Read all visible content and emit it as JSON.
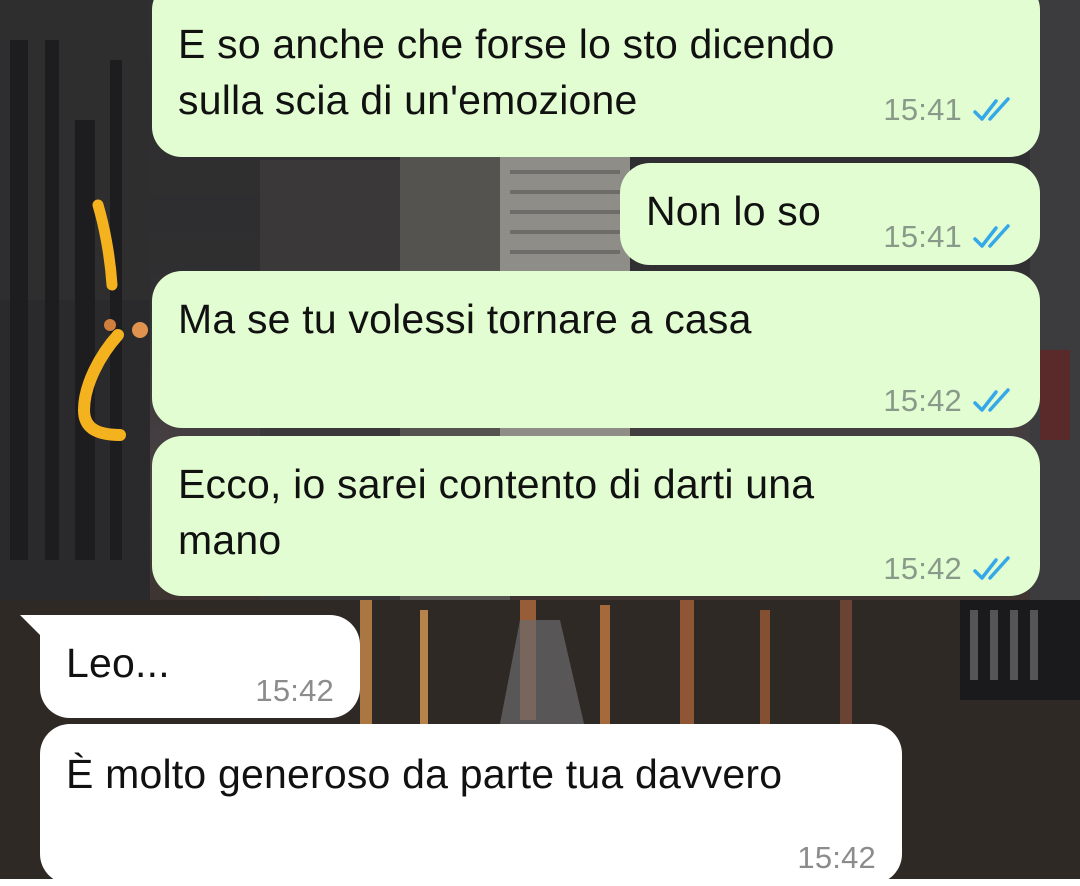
{
  "chat": {
    "messages": [
      {
        "direction": "outgoing",
        "lines": [
          "E so anche che forse lo sto dicendo",
          "sulla scia di un'emozione"
        ],
        "time": "15:41",
        "read_icon": "double-check-icon"
      },
      {
        "direction": "outgoing",
        "lines": [
          "Non lo so"
        ],
        "time": "15:41",
        "read_icon": "double-check-icon"
      },
      {
        "direction": "outgoing",
        "lines": [
          "Ma se tu volessi tornare a casa"
        ],
        "time": "15:42",
        "read_icon": "double-check-icon"
      },
      {
        "direction": "outgoing",
        "lines": [
          "Ecco, io sarei contento di darti una",
          "mano"
        ],
        "time": "15:42",
        "read_icon": "double-check-icon"
      },
      {
        "direction": "incoming",
        "lines": [
          "Leo..."
        ],
        "time": "15:42"
      },
      {
        "direction": "incoming",
        "lines": [
          "È molto generoso da parte tua davvero"
        ],
        "time": "15:42"
      }
    ]
  },
  "colors": {
    "outgoing_bubble": "#e2fdd1",
    "incoming_bubble": "#ffffff",
    "read_ticks": "#34a8e8",
    "annotation_marker": "#f5b21f"
  }
}
